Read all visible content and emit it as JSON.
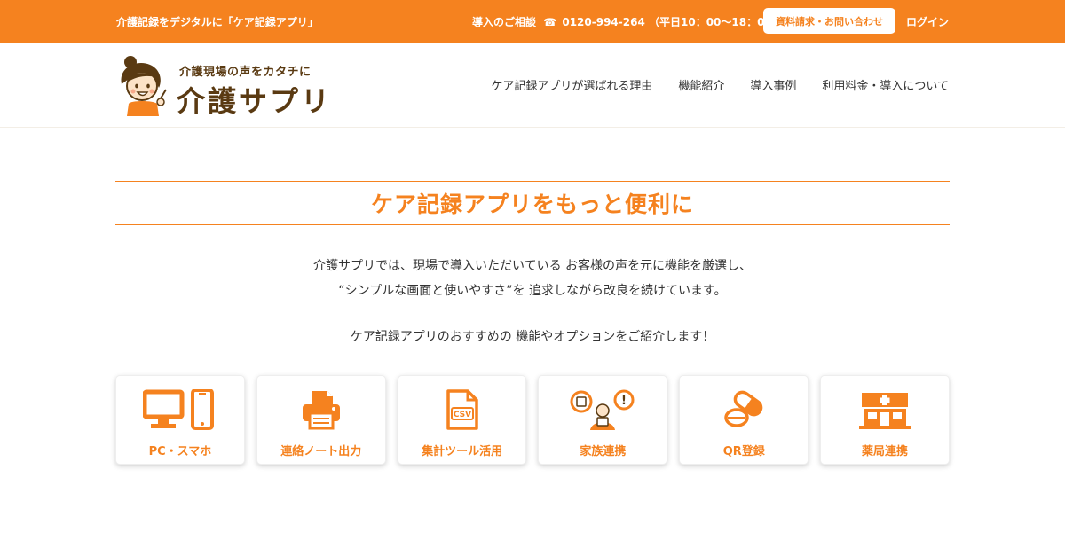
{
  "colors": {
    "accent": "#F5821F",
    "brown": "#5a3a12",
    "text": "#333333"
  },
  "topbar": {
    "tagline": "介護記録をデジタルに「ケア記録アプリ」",
    "contact_label": "導入のご相談",
    "phone_icon": "☎",
    "phone": "0120-994-264",
    "hours": "（平日10：00〜18：00）",
    "inquiry_button": "資料請求・お問い合わせ",
    "login": "ログイン"
  },
  "logo": {
    "sub": "介護現場の声をカタチに",
    "main": "介護サプリ",
    "mascot_icon": "caregiver-mascot"
  },
  "nav": {
    "items": [
      {
        "label": "ケア記録アプリが選ばれる理由"
      },
      {
        "label": "機能紹介"
      },
      {
        "label": "導入事例"
      },
      {
        "label": "利用料金・導入について"
      }
    ]
  },
  "main": {
    "title": "ケア記録アプリをもっと便利に",
    "intro_lines": [
      "介護サプリでは、現場で導入いただいている お客様の声を元に機能を厳選し、",
      "“シンプルな画面と使いやすさ”を 追求しながら改良を続けています。"
    ],
    "intro_last": "ケア記録アプリのおすすめの 機能やオプションをご紹介します！",
    "features": [
      {
        "label": "PC・スマホ",
        "icon": "pc-smartphone-icon"
      },
      {
        "label": "連絡ノート出力",
        "icon": "printer-icon"
      },
      {
        "label": "集計ツール活用",
        "icon": "csv-file-icon"
      },
      {
        "label": "家族連携",
        "icon": "family-chat-icon"
      },
      {
        "label": "QR登録",
        "icon": "pills-icon"
      },
      {
        "label": "薬局連携",
        "icon": "pharmacy-icon"
      }
    ]
  }
}
